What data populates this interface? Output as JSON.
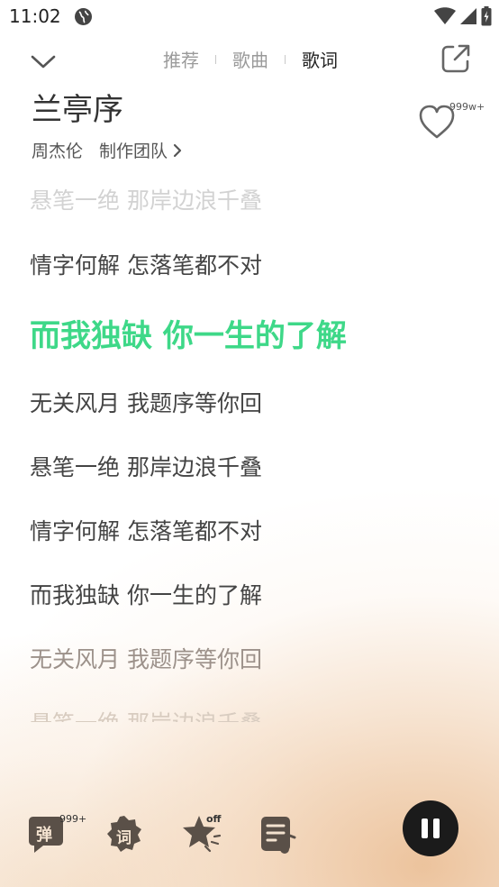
{
  "status_bar": {
    "time": "11:02"
  },
  "nav": {
    "tabs": [
      "推荐",
      "歌曲",
      "歌词"
    ],
    "active_tab": "歌词"
  },
  "song": {
    "title": "兰亭序",
    "artist": "周杰伦",
    "credits_label": "制作团队",
    "like_count": "999w+"
  },
  "lyrics": [
    "悬笔一绝 那岸边浪千叠",
    "情字何解 怎落笔都不对",
    "而我独缺 你一生的了解",
    "无关风月 我题序等你回",
    "悬笔一绝 那岸边浪千叠",
    "情字何解 怎落笔都不对",
    "而我独缺 你一生的了解",
    "无关风月 我题序等你回",
    "悬笔一绝 那岸边浪千叠"
  ],
  "bottom_bar": {
    "danmaku_label": "弹",
    "danmaku_count": "999+",
    "lyric_poster_label": "词",
    "effects_badge": "off"
  },
  "colors": {
    "accent": "#3ed888",
    "text": "#444444",
    "pause_button": "#1b1b1b"
  }
}
